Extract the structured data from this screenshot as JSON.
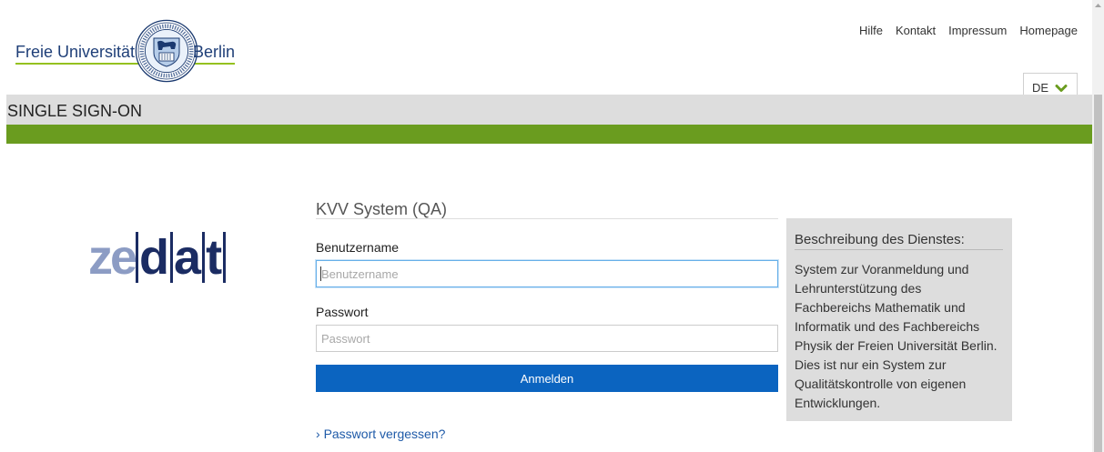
{
  "header": {
    "logo": {
      "left_text": "Freie Universität",
      "right_text": "Berlin",
      "seal_icon": "university-seal-icon"
    },
    "nav": [
      {
        "label": "Hilfe"
      },
      {
        "label": "Kontakt"
      },
      {
        "label": "Impressum"
      },
      {
        "label": "Homepage"
      }
    ],
    "language": {
      "selected": "DE",
      "icon": "chevron-down-icon"
    }
  },
  "title_bar": {
    "text": "SINGLE SIGN-ON"
  },
  "zedat_logo": {
    "light_part": "ze",
    "dark_letters": [
      "d",
      "a",
      "t"
    ]
  },
  "login": {
    "title": "KVV System (QA)",
    "username": {
      "label": "Benutzername",
      "placeholder": "Benutzername",
      "focused": true
    },
    "password": {
      "label": "Passwort",
      "placeholder": "Passwort"
    },
    "submit_label": "Anmelden",
    "forgot_password": {
      "prefix": "›",
      "label": "Passwort vergessen?"
    }
  },
  "service_info": {
    "heading": "Beschreibung des Dienstes:",
    "description_lines": [
      "System zur Voranmeldung und",
      "Lehrunterstützung des",
      "Fachbereichs Mathematik und",
      "Informatik und des Fachbereichs",
      "Physik der Freien Universität Berlin.",
      "Dies ist nur ein System zur",
      "Qualitätskontrolle von eigenen",
      "Entwicklungen."
    ]
  },
  "colors": {
    "brand_green": "#6a9c1f",
    "logo_underline_green": "#95c11f",
    "logo_blue": "#1f3f78",
    "button_blue": "#0b64c0",
    "link_blue": "#1e5aa8",
    "focus_border": "#66afe9",
    "title_bar_gray": "#dddddd",
    "info_box_gray": "#dddddd",
    "zedat_light": "#8c9cc4",
    "zedat_dark": "#1b2c63"
  }
}
